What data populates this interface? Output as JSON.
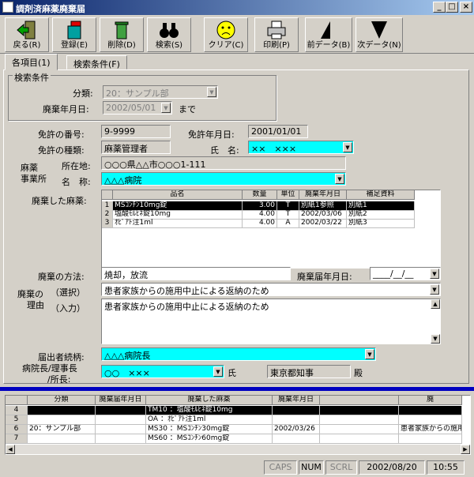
{
  "window": {
    "title": "調剤済麻薬廃棄届"
  },
  "toolbar": [
    {
      "label": "戻る(R)",
      "icon": "exit-door-icon"
    },
    {
      "label": "登録(E)",
      "icon": "save-bucket-icon"
    },
    {
      "label": "削除(D)",
      "icon": "trash-can-icon"
    },
    {
      "label": "検索(S)",
      "icon": "binoculars-icon"
    },
    {
      "label": "クリア(C)",
      "icon": "sad-face-icon"
    },
    {
      "label": "印刷(P)",
      "icon": "printer-icon"
    },
    {
      "label": "前データ(B)",
      "icon": "prev-arrow-icon"
    },
    {
      "label": "次データ(N)",
      "icon": "next-arrow-icon"
    }
  ],
  "tabs": [
    "各項目(1)",
    "検索条件(F)"
  ],
  "search": {
    "group_title": "検索条件",
    "category_label": "分類:",
    "category_value": "20：サンプル部",
    "date_label": "廃棄年月日:",
    "date_value": "2002/05/01",
    "until": "まで"
  },
  "form": {
    "license_no_label": "免許の番号:",
    "license_no": "9-9999",
    "license_date_label": "免許年月日:",
    "license_date": "2001/01/01",
    "license_type_label": "免許の種類:",
    "license_type": "麻薬管理者",
    "name_label": "氏　名:",
    "name": "××　×××",
    "office_label1": "麻薬",
    "office_label2": "事業所",
    "address_label": "所在地:",
    "address": "○○○県△△市○○○1-111",
    "office_name_label": "名　称:",
    "office_name": "△△△病院",
    "disposed_label": "廃棄した麻薬:",
    "method_label": "廃棄の方法:",
    "method": "焼却，放流",
    "report_date_label": "廃棄届年月日:",
    "report_date": "____/__/__",
    "reason_label1": "廃棄の",
    "reason_label2": "理由",
    "select_label": "（選択）",
    "select_value": "患者家族からの施用中止による返納のため",
    "input_label": "（入力）",
    "input_value": "患者家族からの施用中止による返納のため",
    "submitter_label": "届出者続柄:",
    "submitter": "△△△病院長",
    "director_label1": "病院長/理事長",
    "director_label2": "/所長:",
    "director": "○○　×××",
    "shi": "氏",
    "governor": "東京都知事",
    "den": "殿"
  },
  "drug_table": {
    "headers": [
      "",
      "品名",
      "数量",
      "単位",
      "廃棄年月日",
      "補足資料"
    ],
    "rows": [
      [
        "1",
        "MSｺﾝﾁﾝ10mg錠",
        "3.00",
        "T",
        "別紙1参照",
        "別紙1"
      ],
      [
        "2",
        "塩酸ﾓﾙﾋﾈ錠10mg",
        "4.00",
        "T",
        "2002/03/06",
        "別紙2"
      ],
      [
        "3",
        "ｵﾋﾟｱﾄ注1ml",
        "4.00",
        "A",
        "2002/03/22",
        "別紙3"
      ]
    ]
  },
  "list_table": {
    "headers": [
      "",
      "分類",
      "廃棄届年月日",
      "廃棄した麻薬",
      "廃棄年月日",
      "",
      "廃"
    ],
    "rows": [
      [
        "4",
        "",
        "",
        "TM10  ：塩酸ﾓﾙﾋﾈ錠10mg",
        "",
        "",
        ""
      ],
      [
        "5",
        "",
        "",
        "OA    ：ｵﾋﾟｱﾄ注1ml",
        "",
        "",
        ""
      ],
      [
        "6",
        "20：サンプル部",
        "",
        "MS30  ：MSｺﾝﾁﾝ30mg錠",
        "2002/03/26",
        "",
        "患者家族からの施用"
      ],
      [
        "7",
        "",
        "",
        "MS60  ：MSｺﾝﾁﾝ60mg錠",
        "",
        "",
        ""
      ]
    ]
  },
  "status": {
    "caps": "CAPS",
    "num": "NUM",
    "scrl": "SCRL",
    "date": "2002/08/20",
    "time": "10:55"
  }
}
